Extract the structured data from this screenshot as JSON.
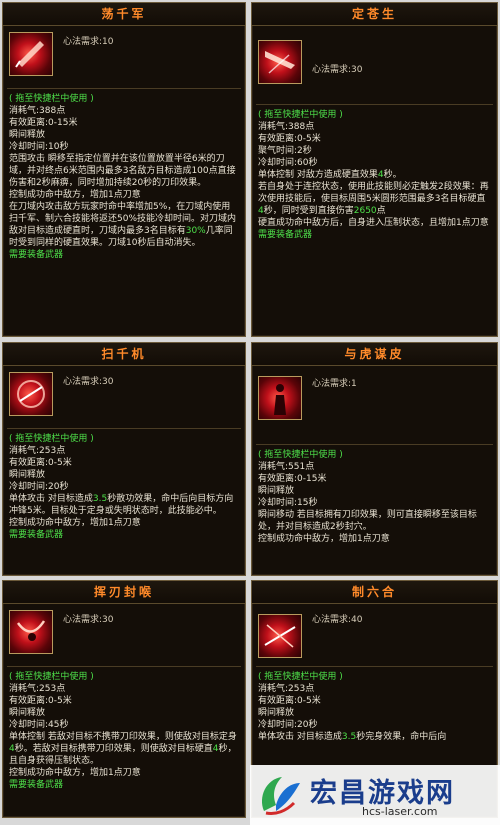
{
  "cards": [
    {
      "title": "荡千军",
      "requirement": "心法需求:10",
      "usage": "( 拖至快捷栏中使用 )",
      "stats": [
        "消耗气:388点",
        "有效距离:0-15米",
        "瞬间释放",
        "冷却时间:10秒"
      ],
      "desc1": "范围攻击 瞬移至指定位置并在该位置放置半径6米的刀域，并对终点6米范围内最多3名敌方目标造成100点直接伤害和2秒麻痹，同时增加持续20秒的刀印效果。",
      "desc2": "控制成功命中敌方，增加1点刀意",
      "desc3_parts": [
        "在刀域内攻击敌方玩家时命中率增加5%，在刀域内使用扫千军、制六合技能将返还50%技能冷却时间。对刀域内敌对目标造成硬直时，刀域内最多3名目标有",
        "30%",
        "几率同时受到同样的硬直效果。刀域10秒后自动消失。"
      ],
      "footer": "需要装备武器"
    },
    {
      "title": "定苍生",
      "requirement": "心法需求:30",
      "usage": "( 拖至快捷栏中使用 )",
      "stats": [
        "消耗气:388点",
        "有效距离:0-5米",
        "聚气时间:2秒",
        "冷却时间:60秒"
      ],
      "desc1_parts": [
        "单体控制 对敌方造成硬直效果",
        "4",
        "秒。"
      ],
      "desc2_parts": [
        "若自身处于连控状态，使用此技能则必定触发2段效果：再次使用技能后，使目标周围5米圆形范围最多3名目标硬直",
        "4",
        "秒，同时受到直接伤害",
        "2650",
        "点"
      ],
      "desc3": "硬直成功命中敌方后，自身进入压制状态，且增加1点刀意",
      "footer": "需要装备武器"
    },
    {
      "title": "扫千机",
      "requirement": "心法需求:30",
      "usage": "( 拖至快捷栏中使用 )",
      "stats": [
        "消耗气:253点",
        "有效距离:0-5米",
        "瞬间释放",
        "冷却时间:20秒"
      ],
      "desc1_parts": [
        "单体攻击 对目标造成",
        "3.5",
        "秒散功效果，命中后向目标方向冲锋5米。目标处于定身或失明状态时，此技能必中。"
      ],
      "desc2": "控制成功命中敌方，增加1点刀意",
      "footer": "需要装备武器"
    },
    {
      "title": "与虎谋皮",
      "requirement": "心法需求:1",
      "usage": "( 拖至快捷栏中使用 )",
      "stats": [
        "消耗气:551点",
        "有效距离:0-15米",
        "瞬间释放",
        "冷却时间:15秒"
      ],
      "desc1": "瞬间移动 若目标拥有刀印效果，则可直接瞬移至该目标处，并对目标造成2秒封穴。",
      "desc2": "控制成功命中敌方，增加1点刀意"
    },
    {
      "title": "挥刃封喉",
      "requirement": "心法需求:30",
      "usage": "( 拖至快捷栏中使用 )",
      "stats": [
        "消耗气:253点",
        "有效距离:0-5米",
        "瞬间释放",
        "冷却时间:45秒"
      ],
      "desc1_parts": [
        "单体控制 若敌对目标不携带刀印效果，则使敌对目标定身",
        "4",
        "秒。若敌对目标携带刀印效果，则使敌对目标硬直",
        "4",
        "秒，且自身获得压制状态。"
      ],
      "desc2": "控制成功命中敌方，增加1点刀意",
      "footer": "需要装备武器"
    },
    {
      "title": "制六合",
      "requirement": "心法需求:40",
      "usage": "( 拖至快捷栏中使用 )",
      "stats": [
        "消耗气:253点",
        "有效距离:0-5米",
        "瞬间释放",
        "冷却时间:20秒"
      ],
      "desc1_parts": [
        "单体攻击 对目标造成",
        "3.5",
        "秒完身效果，命中后向"
      ]
    }
  ],
  "watermark": {
    "text": "宏昌游戏网",
    "url": "hcs-laser.com"
  },
  "colors": {
    "title": "#ff8a2a",
    "green": "#4ee04a",
    "card_bg": "#140e08",
    "border": "#6b5a3a"
  }
}
